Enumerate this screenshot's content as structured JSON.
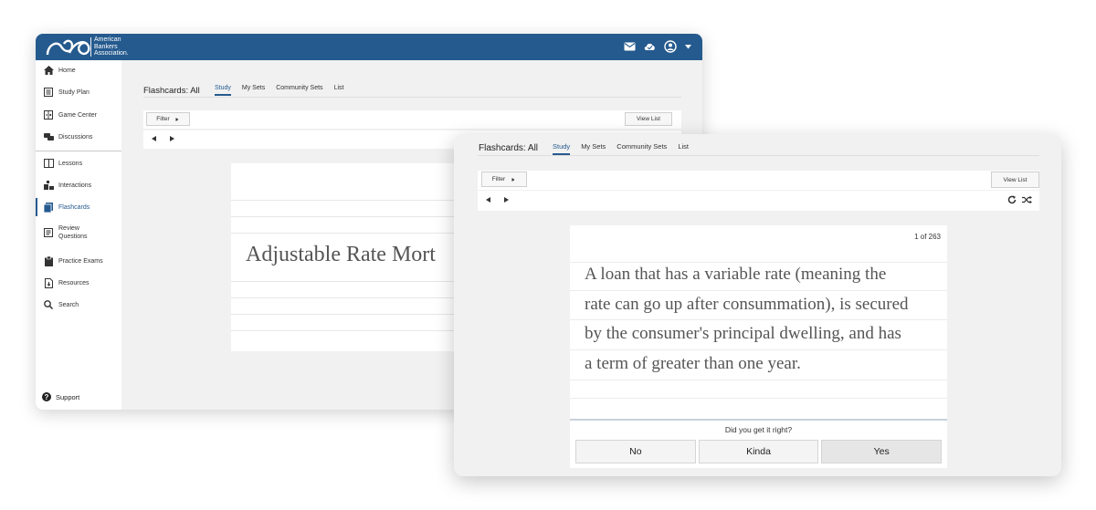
{
  "brand": {
    "name_lines": [
      "American",
      "Bankers",
      "Association."
    ],
    "color": "#255a8e"
  },
  "topbar": {
    "icons": [
      "mail-icon",
      "cloud-check-icon",
      "user-account-icon",
      "caret-down-icon"
    ]
  },
  "sidebar": {
    "items": [
      {
        "label": "Home",
        "icon": "home-icon"
      },
      {
        "label": "Study Plan",
        "icon": "study-plan-icon"
      },
      {
        "label": "Game Center",
        "icon": "game-center-icon"
      },
      {
        "label": "Discussions",
        "icon": "discussions-icon"
      },
      {
        "label": "Lessons",
        "icon": "lessons-icon"
      },
      {
        "label": "Interactions",
        "icon": "interactions-icon"
      },
      {
        "label": "Flashcards",
        "icon": "flashcards-icon",
        "active": true
      },
      {
        "label": "Review Questions",
        "icon": "review-questions-icon"
      },
      {
        "label": "Practice Exams",
        "icon": "practice-exams-icon"
      },
      {
        "label": "Resources",
        "icon": "resources-icon"
      },
      {
        "label": "Search",
        "icon": "search-icon"
      }
    ],
    "support_label": "Support"
  },
  "flashcards": {
    "title": "Flashcards: All",
    "tabs": [
      "Study",
      "My Sets",
      "Community Sets",
      "List"
    ],
    "active_tab": "Study",
    "filter_label": "Filter",
    "view_list_label": "View List"
  },
  "back_card": {
    "front_text": "Adjustable Rate Mort"
  },
  "front_card": {
    "counter": "1 of 263",
    "answer_lines": [
      "A loan that has a variable rate (meaning the",
      "rate can go up after consummation), is secured",
      "by the consumer's principal dwelling, and has",
      "a term of greater than one year."
    ],
    "prompt": "Did you get it right?",
    "grades": [
      "No",
      "Kinda",
      "Yes"
    ],
    "selected_grade": "Yes"
  }
}
